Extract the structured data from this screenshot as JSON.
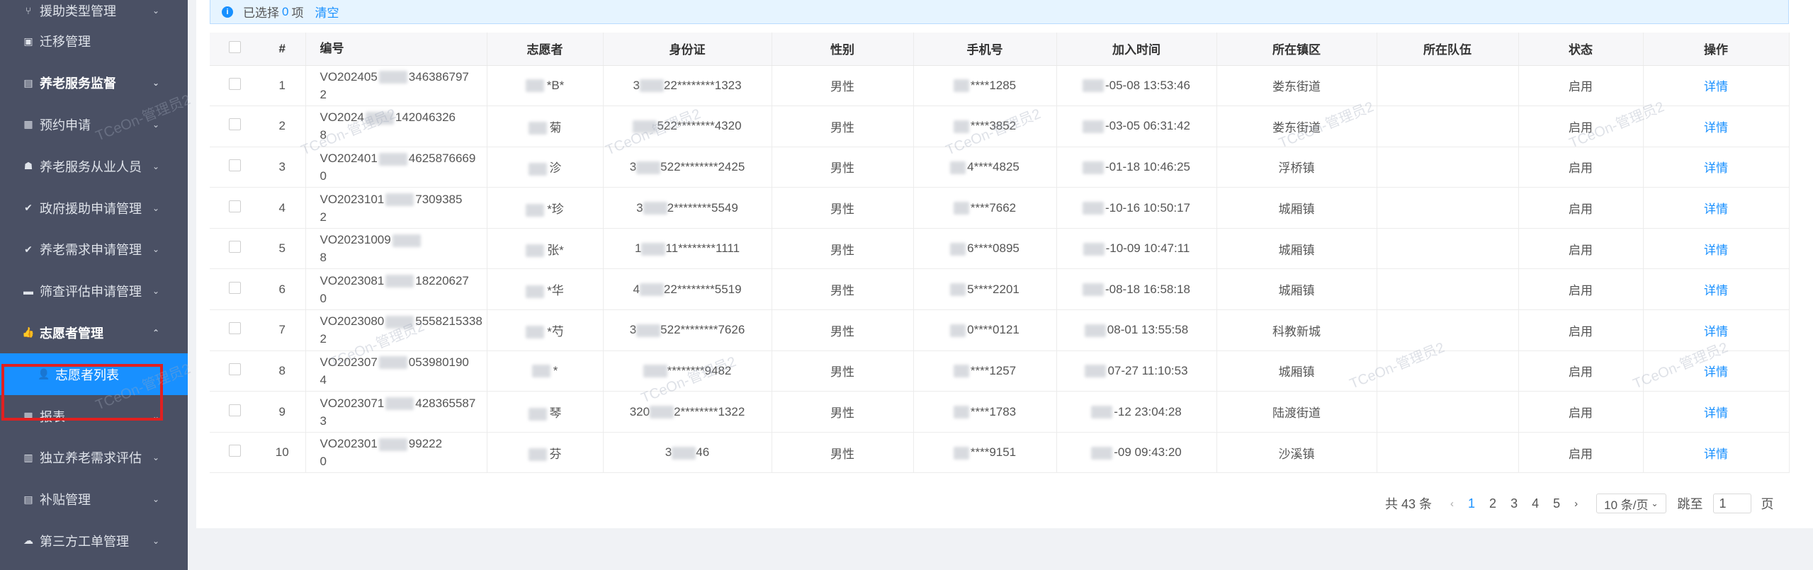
{
  "sidebar": {
    "items": [
      {
        "label": "援助类型管理",
        "icon": "branch-icon",
        "chevron": "⌄"
      },
      {
        "label": "迁移管理",
        "icon": "migrate-icon",
        "chevron": ""
      },
      {
        "label": "养老服务监督",
        "icon": "clipboard-icon",
        "chevron": "⌄"
      },
      {
        "label": "预约申请",
        "icon": "calendar-icon",
        "chevron": "⌄"
      },
      {
        "label": "养老服务从业人员",
        "icon": "group-icon",
        "chevron": "⌄"
      },
      {
        "label": "政府援助申请管理",
        "icon": "check-circle-icon",
        "chevron": "⌄"
      },
      {
        "label": "养老需求申请管理",
        "icon": "check-circle-icon",
        "chevron": "⌄"
      },
      {
        "label": "筛查评估申请管理",
        "icon": "card-icon",
        "chevron": "⌄"
      },
      {
        "label": "志愿者管理",
        "icon": "thumbs-up-icon",
        "chevron": "⌃"
      },
      {
        "label": "志愿者列表",
        "icon": "user-icon",
        "chevron": ""
      },
      {
        "label": "报表",
        "icon": "calendar-icon",
        "chevron": "⌄"
      },
      {
        "label": "独立养老需求评估",
        "icon": "form-icon",
        "chevron": "⌄"
      },
      {
        "label": "补贴管理",
        "icon": "document-icon",
        "chevron": "⌄"
      },
      {
        "label": "第三方工单管理",
        "icon": "cloud-icon",
        "chevron": "⌄"
      }
    ]
  },
  "alert": {
    "prefix": "已选择",
    "count": "0",
    "suffix": "项",
    "clear": "清空"
  },
  "table": {
    "headers": [
      "#",
      "编号",
      "志愿者",
      "身份证",
      "性别",
      "手机号",
      "加入时间",
      "所在镇区",
      "所在队伍",
      "状态",
      "操作"
    ],
    "rows": [
      {
        "n": "1",
        "code1": "VO202405",
        "code2": "346386797",
        "code3": "2",
        "name": "*B*",
        "id1": "3",
        "id2": "22********1323",
        "gender": "男性",
        "phone": "****1285",
        "time": "-05-08 13:53:46",
        "town": "娄东街道",
        "team": "",
        "status": "启用",
        "action": "详情"
      },
      {
        "n": "2",
        "code1": "VO2024",
        "code2": "142046326",
        "code3": "8",
        "name": "菊",
        "id1": "",
        "id2": "522********4320",
        "gender": "男性",
        "phone": "****3852",
        "time": "-03-05 06:31:42",
        "town": "娄东街道",
        "team": "",
        "status": "启用",
        "action": "详情"
      },
      {
        "n": "3",
        "code1": "VO202401",
        "code2": "4625876669",
        "code3": "0",
        "name": "沴",
        "id1": "3",
        "id2": "522********2425",
        "gender": "男性",
        "phone": "4****4825",
        "time": "-01-18 10:46:25",
        "town": "浮桥镇",
        "team": "",
        "status": "启用",
        "action": "详情"
      },
      {
        "n": "4",
        "code1": "VO2023101",
        "code2": "7309385",
        "code3": "2",
        "name": "*珍",
        "id1": "3",
        "id2": "2********5549",
        "gender": "男性",
        "phone": "****7662",
        "time": "-10-16 10:50:17",
        "town": "城厢镇",
        "team": "",
        "status": "启用",
        "action": "详情"
      },
      {
        "n": "5",
        "code1": "VO20231009",
        "code2": "",
        "code3": "8",
        "name": "张*",
        "id1": "1",
        "id2": "11********1111",
        "gender": "男性",
        "phone": "6****0895",
        "time": "-10-09 10:47:11",
        "town": "城厢镇",
        "team": "",
        "status": "启用",
        "action": "详情"
      },
      {
        "n": "6",
        "code1": "VO2023081",
        "code2": "18220627",
        "code3": "0",
        "name": "*华",
        "id1": "4",
        "id2": "22********5519",
        "gender": "男性",
        "phone": "5****2201",
        "time": "-08-18 16:58:18",
        "town": "城厢镇",
        "team": "",
        "status": "启用",
        "action": "详情"
      },
      {
        "n": "7",
        "code1": "VO2023080",
        "code2": "5558215338",
        "code3": "2",
        "name": "*芍",
        "id1": "3",
        "id2": "522********7626",
        "gender": "男性",
        "phone": "0****0121",
        "time": "08-01 13:55:58",
        "town": "科教新城",
        "team": "",
        "status": "启用",
        "action": "详情"
      },
      {
        "n": "8",
        "code1": "VO202307",
        "code2": "053980190",
        "code3": "4",
        "name": "*",
        "id1": "",
        "id2": "********9482",
        "gender": "男性",
        "phone": "****1257",
        "time": "07-27 11:10:53",
        "town": "城厢镇",
        "team": "",
        "status": "启用",
        "action": "详情"
      },
      {
        "n": "9",
        "code1": "VO2023071",
        "code2": "428365587",
        "code3": "3",
        "name": "琴",
        "id1": "320",
        "id2": "2********1322",
        "gender": "男性",
        "phone": "****1783",
        "time": "-12 23:04:28",
        "town": "陆渡街道",
        "team": "",
        "status": "启用",
        "action": "详情"
      },
      {
        "n": "10",
        "code1": "VO202301",
        "code2": "99222",
        "code3": "0",
        "name": "芬",
        "id1": "3",
        "id2": "46",
        "gender": "男性",
        "phone": "****9151",
        "time": "-09 09:43:20",
        "town": "沙溪镇",
        "team": "",
        "status": "启用",
        "action": "详情"
      }
    ]
  },
  "pagination": {
    "total": "共 43 条",
    "pages": [
      "1",
      "2",
      "3",
      "4",
      "5"
    ],
    "current": "1",
    "page_size": "10 条/页",
    "jump_label": "跳至",
    "jump_value": "1",
    "page_suffix": "页"
  },
  "watermark": "TCeOn-管理员2",
  "colors": {
    "sidebar": "#4a5064",
    "accent": "#1890ff",
    "highlight": "#e02020"
  }
}
